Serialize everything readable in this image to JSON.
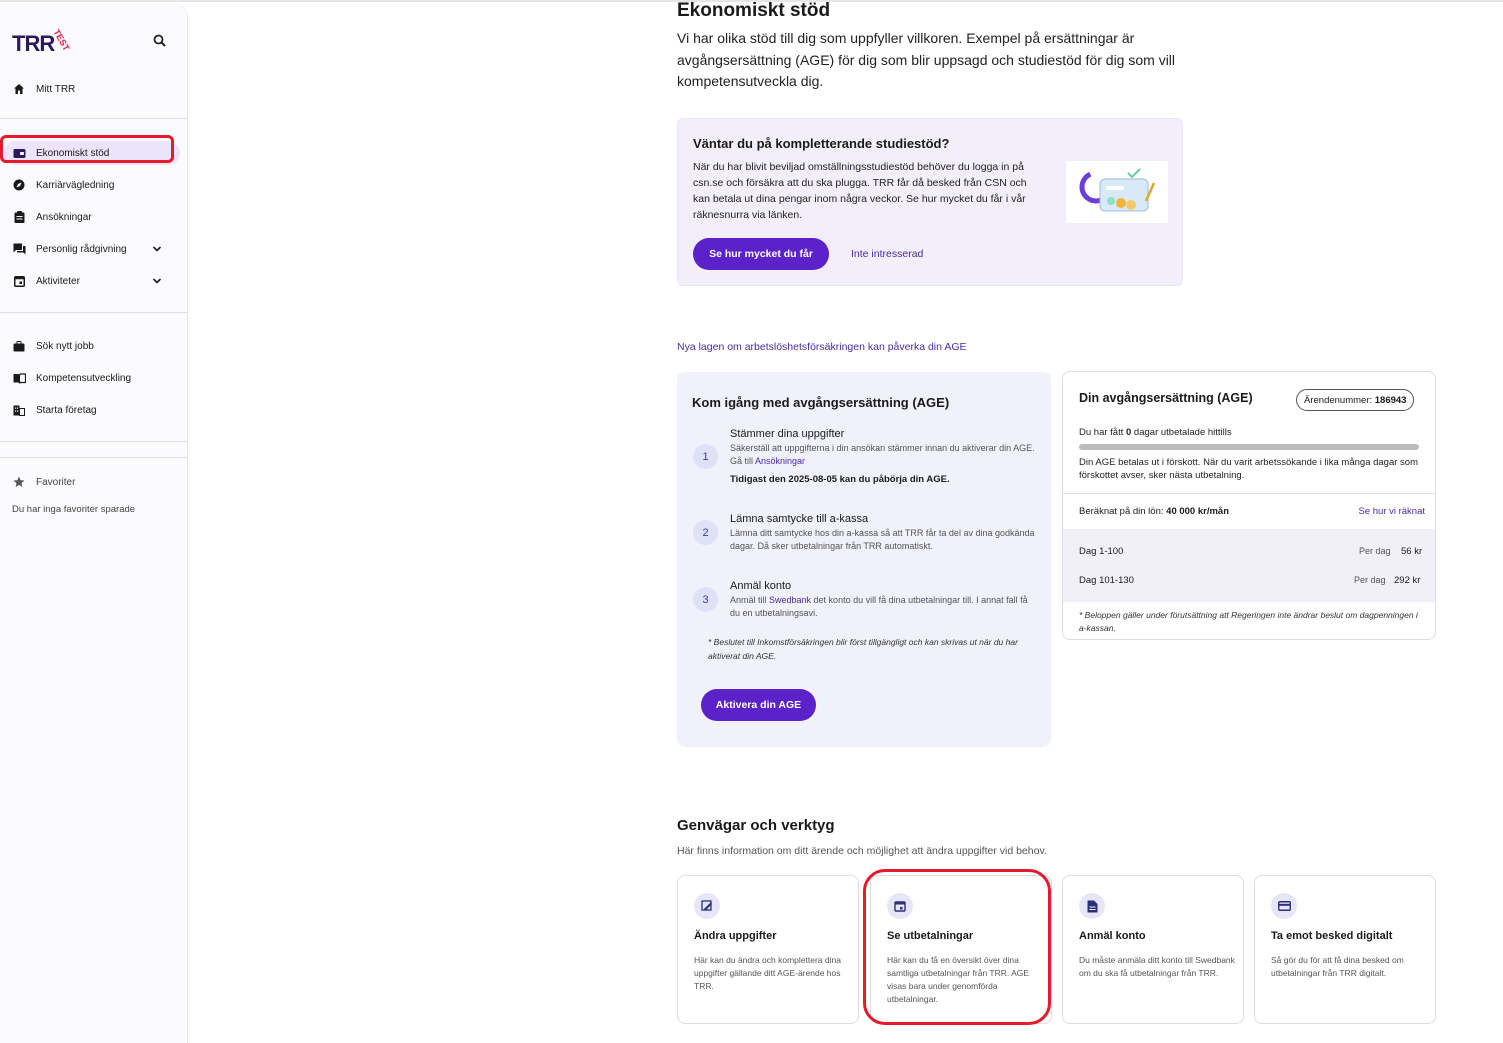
{
  "brand": {
    "name": "TRR",
    "badge": "TEST"
  },
  "sidebar": {
    "top_items": [
      {
        "label": "Mitt TRR",
        "icon": "home-icon"
      }
    ],
    "active_item": {
      "label": "Ekonomiskt stöd",
      "icon": "wallet-icon"
    },
    "items": [
      {
        "label": "Karriärvägledning",
        "icon": "compass-icon"
      },
      {
        "label": "Ansökningar",
        "icon": "clipboard-icon"
      },
      {
        "label": "Personlig rådgivning",
        "icon": "chat-icon"
      },
      {
        "label": "Aktiviteter",
        "icon": "calendar-icon"
      }
    ],
    "tools": [
      {
        "label": "Sök nytt jobb",
        "icon": "briefcase-icon"
      },
      {
        "label": "Kompetensutveckling",
        "icon": "book-icon"
      },
      {
        "label": "Starta företag",
        "icon": "building-icon"
      }
    ],
    "favorites": {
      "label": "Favoriter",
      "empty_text": "Du har inga favoriter sparade"
    }
  },
  "main": {
    "title": "Ekonomiskt stöd",
    "intro": "Vi har olika stöd till dig som uppfyller villkoren. Exempel på ersättningar är avgångsersättning (AGE) för dig som blir uppsagd och studiestöd för dig som vill kompetensutveckla dig.",
    "promo": {
      "title": "Väntar du på kompletterande studiestöd?",
      "text": "När du har blivit beviljad omställningsstudiestöd behöver du logga in på csn.se och försäkra att du ska plugga. TRR får då besked från CSN och kan betala ut dina pengar inom några veckor. Se hur mycket du får i vår räknesnurra via länken.",
      "primary": "Se hur mycket du får",
      "secondary": "Inte intresserad"
    },
    "age_law_link": "Nya lagen om arbetslöshetsförsäkringen kan påverka din AGE",
    "kom_igang": {
      "title": "Kom igång med avgångsersättning (AGE)",
      "steps": [
        {
          "num": "1",
          "title": "Stämmer dina uppgifter",
          "text": "Säkerställ att uppgifterna i din ansökan stämmer innan du aktiverar din AGE. Gå till ",
          "link": "Ansökningar",
          "bold": "Tidigast den 2025-08-05 kan du påbörja din AGE."
        },
        {
          "num": "2",
          "title": "Lämna samtycke till a-kassa",
          "text": "Lämna ditt samtycke hos din a-kassa så att TRR får ta del av dina godkända dagar. Då sker utbetalningar från TRR automatiskt."
        },
        {
          "num": "3",
          "title": "Anmäl konto",
          "text_pre": "Anmäl till ",
          "link": "Swedbank",
          "text_post": " det konto du vill få dina utbetalningar till. I annat fall få du en utbetalningsavi."
        }
      ],
      "note": "* Beslutet till Inkomstförsäkringen blir först tillgängligt och kan skrivas ut när du har aktiverat din AGE.",
      "button": "Aktivera din AGE"
    },
    "din_age": {
      "title": "Din avgångsersättning (AGE)",
      "case_label": "Ärendenummer:",
      "case_number": "186943",
      "paid_pre": "Du har fått ",
      "paid_days": "0",
      "paid_post": " dagar utbetalade hittills",
      "paid_fraction": 0,
      "desc": "Din AGE betalas ut i förskott. När du varit arbetssökande i lika många dagar som förskottet avser, sker nästa utbetalning.",
      "salary_label": "Beräknat på din lön: ",
      "salary_value": "40 000 kr/mån",
      "how_link": "Se hur vi räknat",
      "rows": [
        {
          "label": "Dag 1-100",
          "per": "Per dag",
          "value": "56 kr"
        },
        {
          "label": "Dag 101-130",
          "per": "Per dag",
          "value": "292 kr"
        }
      ],
      "note": "* Beloppen gäller under förutsättning att Regeringen inte ändrar beslut om dagpenningen i a-kassan."
    },
    "shortcuts": {
      "title": "Genvägar och verktyg",
      "subtitle": "Här finns information om ditt ärende och möjlighet att ändra uppgifter vid behov.",
      "cards": [
        {
          "title": "Ändra uppgifter",
          "text": "Här kan du ändra och komplettera dina uppgifter gällande ditt AGE-ärende hos TRR.",
          "icon": "edit-document-icon"
        },
        {
          "title": "Se utbetalningar",
          "text": "Här kan du få en översikt över dina samtliga utbetalningar från TRR. AGE visas bara under genomförda utbetalningar.",
          "icon": "calendar-icon"
        },
        {
          "title": "Anmäl konto",
          "text": "Du måste anmäla ditt konto till Swedbank om du ska få utbetalningar från TRR.",
          "icon": "document-icon"
        },
        {
          "title": "Ta emot besked digitalt",
          "text": "Så gör du för att få dina besked om utbetalningar från TRR digitalt.",
          "icon": "credit-card-icon"
        }
      ]
    }
  },
  "colors": {
    "accent": "#5a22c8",
    "link": "#4b2aa8",
    "highlight": "#e31b2d",
    "promo_bg": "#f2effa",
    "card_bg": "#f0f1fb"
  }
}
